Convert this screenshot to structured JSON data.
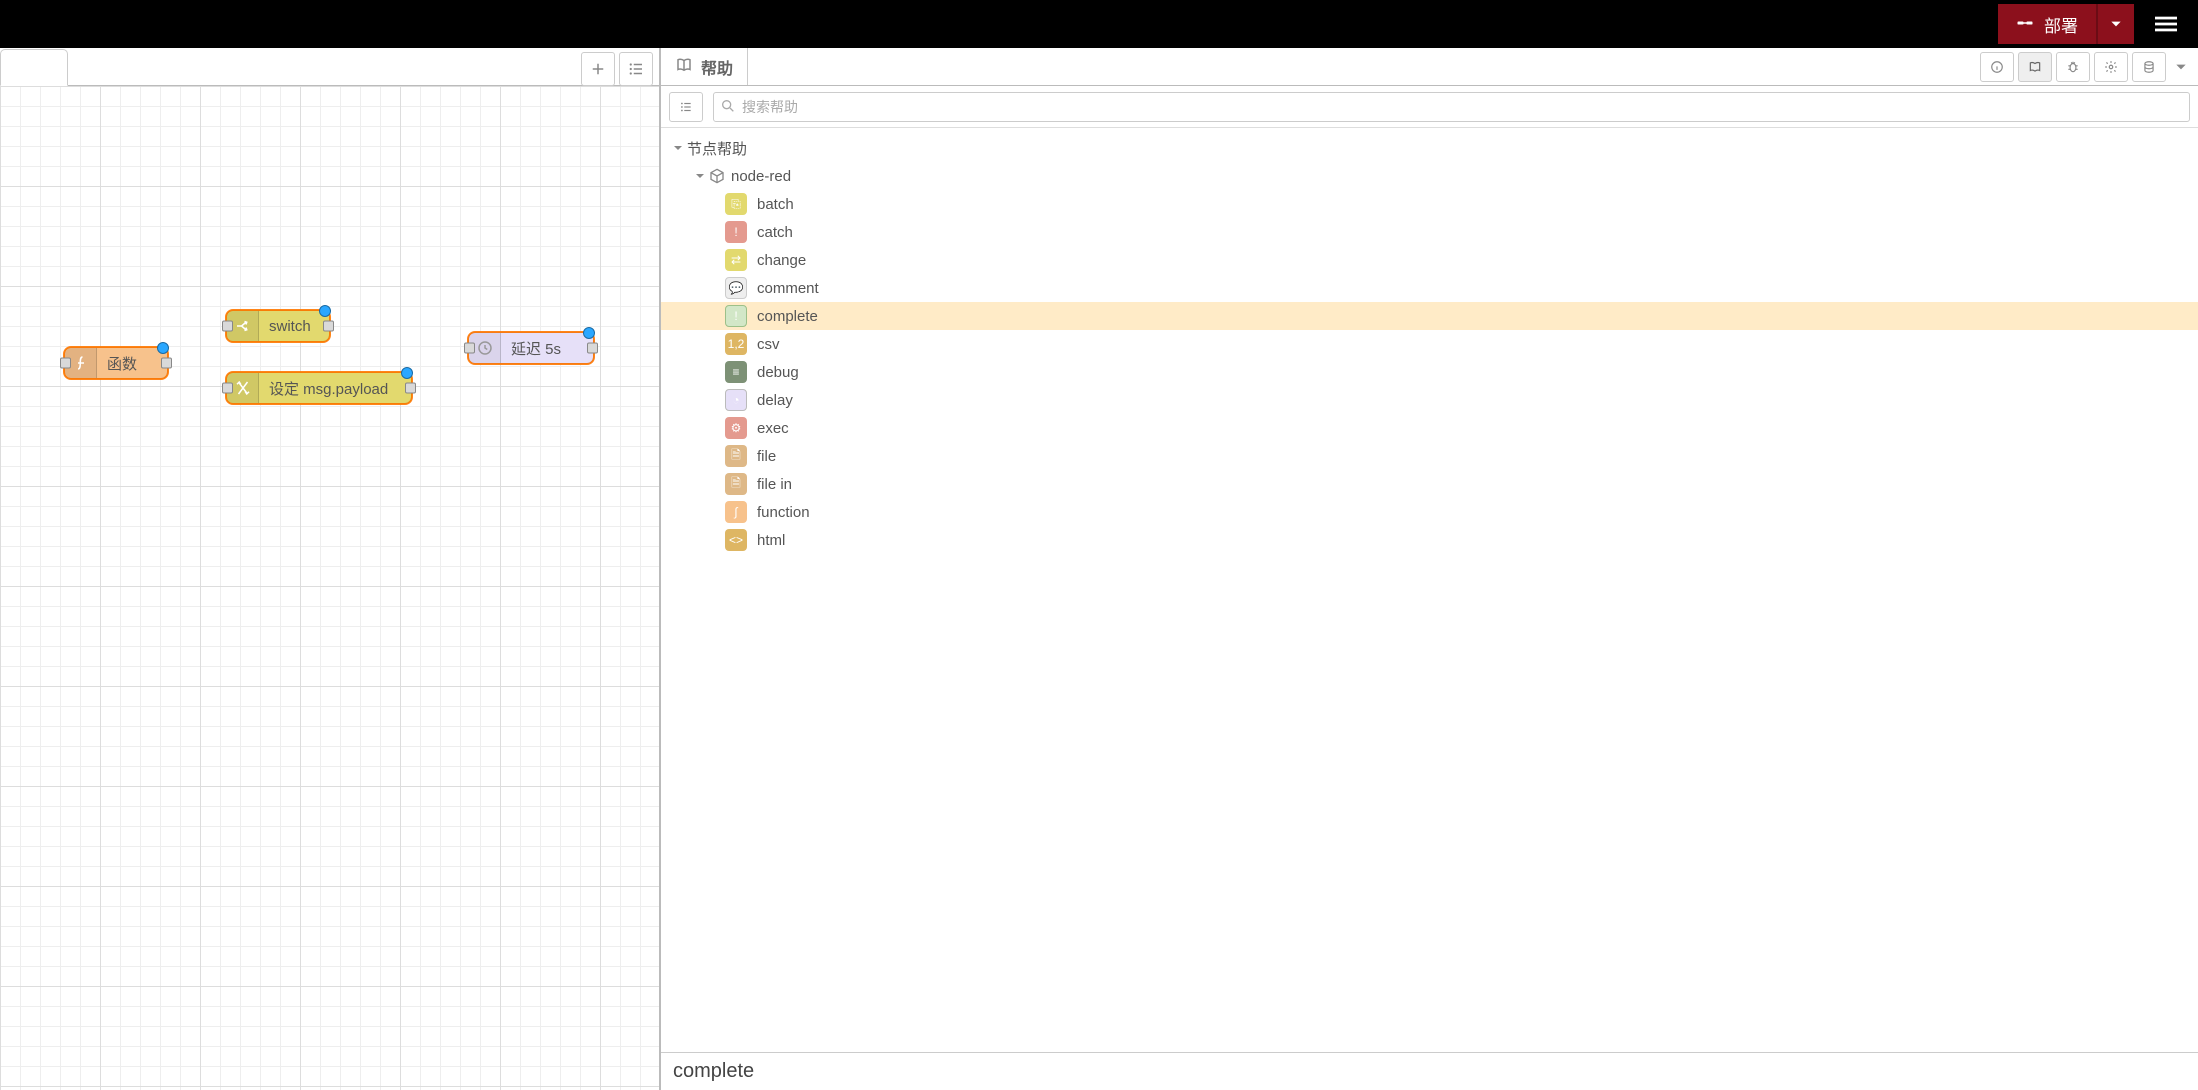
{
  "header": {
    "deploy_label": "部署"
  },
  "editor": {
    "nodes": {
      "function": {
        "label": "函数"
      },
      "switch": {
        "label": "switch"
      },
      "change": {
        "label": "设定 msg.payload"
      },
      "delay": {
        "label": "延迟 5s"
      }
    }
  },
  "sidebar": {
    "tab_label": "帮助",
    "search_placeholder": "搜索帮助",
    "tree": {
      "section_label": "节点帮助",
      "module_label": "node-red",
      "items": [
        {
          "id": "batch",
          "label": "batch",
          "cls": "pi-batch"
        },
        {
          "id": "catch",
          "label": "catch",
          "cls": "pi-catch"
        },
        {
          "id": "change",
          "label": "change",
          "cls": "pi-change"
        },
        {
          "id": "comment",
          "label": "comment",
          "cls": "pi-comment"
        },
        {
          "id": "complete",
          "label": "complete",
          "cls": "pi-complete",
          "selected": true
        },
        {
          "id": "csv",
          "label": "csv",
          "cls": "pi-csv"
        },
        {
          "id": "debug",
          "label": "debug",
          "cls": "pi-debug"
        },
        {
          "id": "delay",
          "label": "delay",
          "cls": "pi-delay"
        },
        {
          "id": "exec",
          "label": "exec",
          "cls": "pi-exec"
        },
        {
          "id": "file",
          "label": "file",
          "cls": "pi-file"
        },
        {
          "id": "file in",
          "label": "file in",
          "cls": "pi-filein"
        },
        {
          "id": "function",
          "label": "function",
          "cls": "pi-function"
        },
        {
          "id": "html",
          "label": "html",
          "cls": "pi-html"
        }
      ]
    },
    "detail_title": "complete"
  }
}
